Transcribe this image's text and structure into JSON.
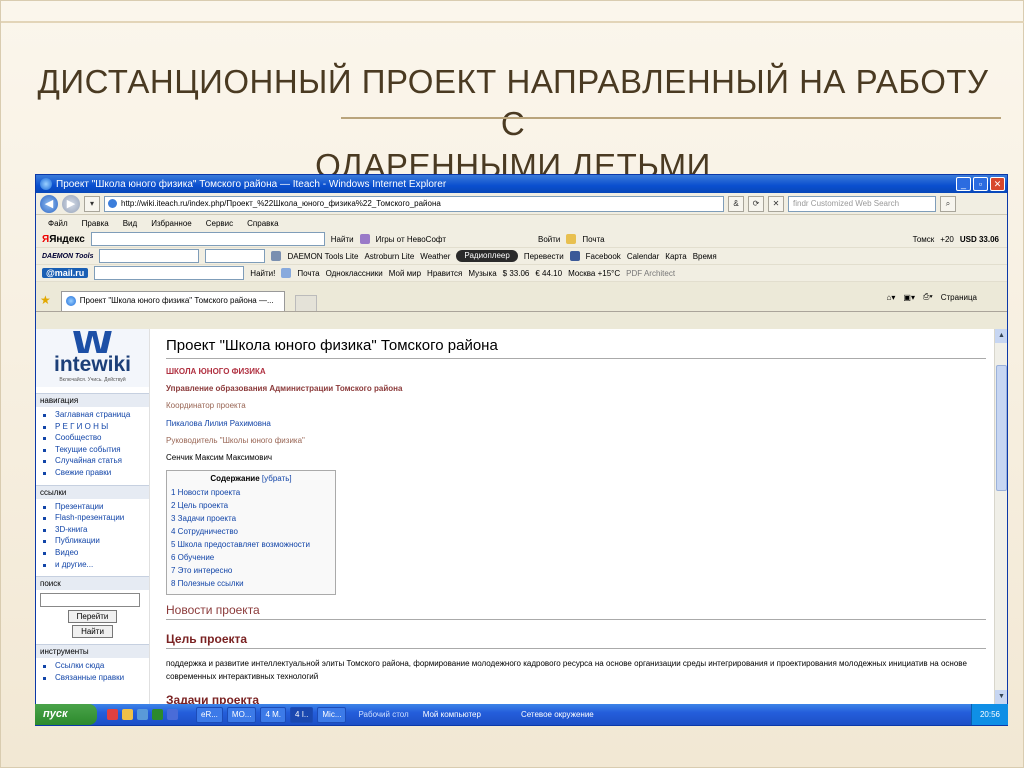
{
  "slide": {
    "title_line1": "ДИСТАНЦИОННЫЙ ПРОЕКТ НАПРАВЛЕННЫЙ НА РАБОТУ С",
    "title_line2": "ОДАРЕННЫМИ ДЕТЬМИ"
  },
  "browser": {
    "window_title": "Проект \"Школа юного физика\" Томского района — Iteach - Windows Internet Explorer",
    "address": "http://wiki.iteach.ru/index.php/Проект_%22Школа_юного_физика%22_Томского_района",
    "search_placeholder": "findr Customized Web Search",
    "menu": [
      "Файл",
      "Правка",
      "Вид",
      "Избранное",
      "Сервис",
      "Справка"
    ],
    "toolbar1": {
      "yandex": "Яндекс",
      "find": "Найти",
      "games": "Игры от НевоСофт",
      "login": "Войти",
      "mail": "Почта",
      "weather_city": "Томск",
      "weather_temp": "+20",
      "usd": "USD 33.06"
    },
    "toolbar2": {
      "daemon": "DAEMON Tools",
      "daemon_lite": "DAEMON Tools Lite",
      "astroburn": "Astroburn Lite",
      "weather": "Weather",
      "radio": "Радиоплеер",
      "translate": "Перевести",
      "facebook": "Facebook",
      "calendar": "Calendar",
      "map": "Карта",
      "time": "Время"
    },
    "toolbar3": {
      "mailru": "@mail.ru",
      "find": "Найти!",
      "mail": "Почта",
      "ok": "Одноклассники",
      "mymir": "Мой мир",
      "like": "Нравится",
      "music": "Музыка",
      "usd": "$ 33.06",
      "eur": "€ 44.10",
      "moscow": "Москва +15°C",
      "pdf": "PDF Architect"
    },
    "tab_label": "Проект \"Школа юного физика\" Томского района —...",
    "page_cmd": "Страница"
  },
  "wiki": {
    "logo": "intewiki",
    "logo_tag": "Включайся. Учись. Действуй",
    "nav_title": "навигация",
    "nav": [
      "Заглавная страница",
      "Р Е Г И О Н Ы",
      "Сообщество",
      "Текущие события",
      "Случайная статья",
      "Свежие правки"
    ],
    "links_title": "ссылки",
    "links": [
      "Презентации",
      "Flash-презентации",
      "3D-книга",
      "Публикации",
      "Видео",
      "и другие..."
    ],
    "search_title": "поиск",
    "go_btn": "Перейти",
    "find_btn": "Найти",
    "tools_title": "инструменты",
    "tools": [
      "Ссылки сюда",
      "Связанные правки"
    ]
  },
  "article": {
    "title": "Проект \"Школа юного физика\" Томского района",
    "school": "ШКОЛА ЮНОГО ФИЗИКА",
    "dept": "Управление образования Администрации Томского района",
    "coord_label": "Координатор проекта",
    "coord_name": "Пикалова Лилия Рахимовна",
    "head_label": "Руководитель \"Школы юного физика\"",
    "head_name": "Сенчик Максим Максимович",
    "toc_title": "Содержание",
    "toc_hide": "[убрать]",
    "toc": [
      "1 Новости проекта",
      "2 Цель проекта",
      "3 Задачи проекта",
      "4 Сотрудничество",
      "5 Школа предоставляет возможности",
      "6 Обучение",
      "7 Это интересно",
      "8 Полезные ссылки"
    ],
    "h_news": "Новости проекта",
    "h_goal": "Цель проекта",
    "goal_text": "поддержка и развитие интеллектуальной элиты Томского района, формирование молодежного кадрового ресурса на основе организации среды интегрирования и проектирования молодежных инициатив на основе современных интерактивных технологий",
    "h_tasks": "Задачи проекта"
  },
  "taskbar": {
    "start": "пуск",
    "items": [
      "eR...",
      "МО...",
      "4 M.",
      "4 I..",
      "Mic..."
    ],
    "desktop": "Рабочий стол",
    "mycomp": "Мой компьютер",
    "network": "Сетевое окружение",
    "time": "20:56"
  }
}
